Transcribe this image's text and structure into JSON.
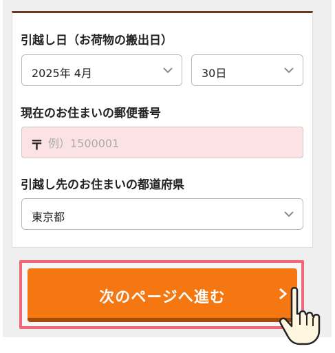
{
  "form": {
    "move_date_label": "引越し日（お荷物の搬出日）",
    "move_month_value": "2025年 4月",
    "move_day_value": "30日",
    "postal_label": "現在のお住まいの郵便番号",
    "postal_mark": "〒",
    "postal_placeholder": "例）1500001",
    "pref_label": "引越し先のお住まいの都道府県",
    "pref_value": "東京都"
  },
  "cta": {
    "label": "次のページへ進む"
  },
  "icons": {
    "select_chevron": "chevron-down-icon",
    "cta_arrow": "chevron-right-icon",
    "pointer": "pointing-hand-icon"
  },
  "colors": {
    "accent_brown": "#6a3b24",
    "cta_orange": "#f47712",
    "cta_outline": "#f2677a",
    "input_error_bg": "#fde2e4"
  }
}
